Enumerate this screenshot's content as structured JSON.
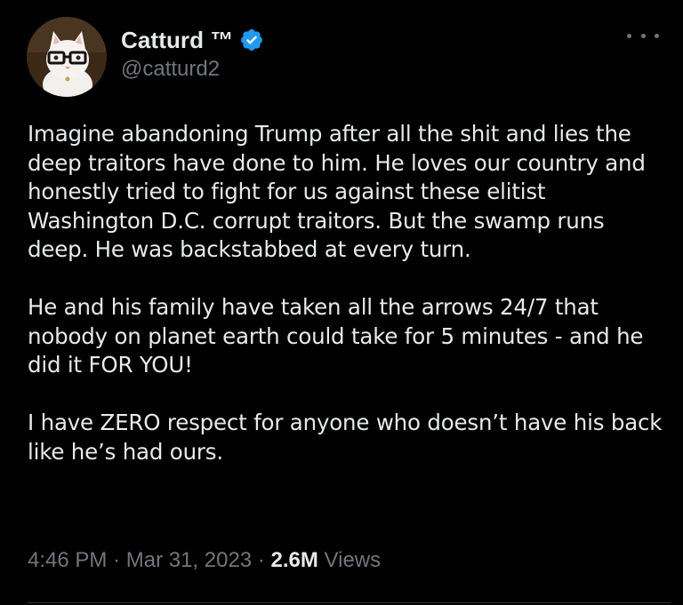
{
  "author": {
    "display_name": "Catturd ™",
    "handle": "@catturd2",
    "verified_icon": "verified-badge-icon",
    "avatar_icon": "cat-with-glasses-avatar"
  },
  "post": {
    "paragraphs": [
      "Imagine abandoning Trump after all the shit and lies the deep traitors have done to him. He loves our country and honestly tried to fight for us against these elitist Washington D.C. corrupt traitors. But the swamp runs deep. He was backstabbed at every turn.",
      "He and his family have taken all the arrows 24/7 that nobody on planet earth could take for 5 minutes - and he did it FOR YOU!",
      "I have ZERO respect for anyone who doesn’t have his back like he’s had ours."
    ]
  },
  "meta": {
    "time": "4:46 PM",
    "separator": "·",
    "date": "Mar 31, 2023",
    "views_count": "2.6M",
    "views_label": "Views"
  },
  "colors": {
    "background": "#000000",
    "text_primary": "#e7e9ea",
    "text_secondary": "#71767b",
    "verified_blue": "#1d9bf0"
  }
}
